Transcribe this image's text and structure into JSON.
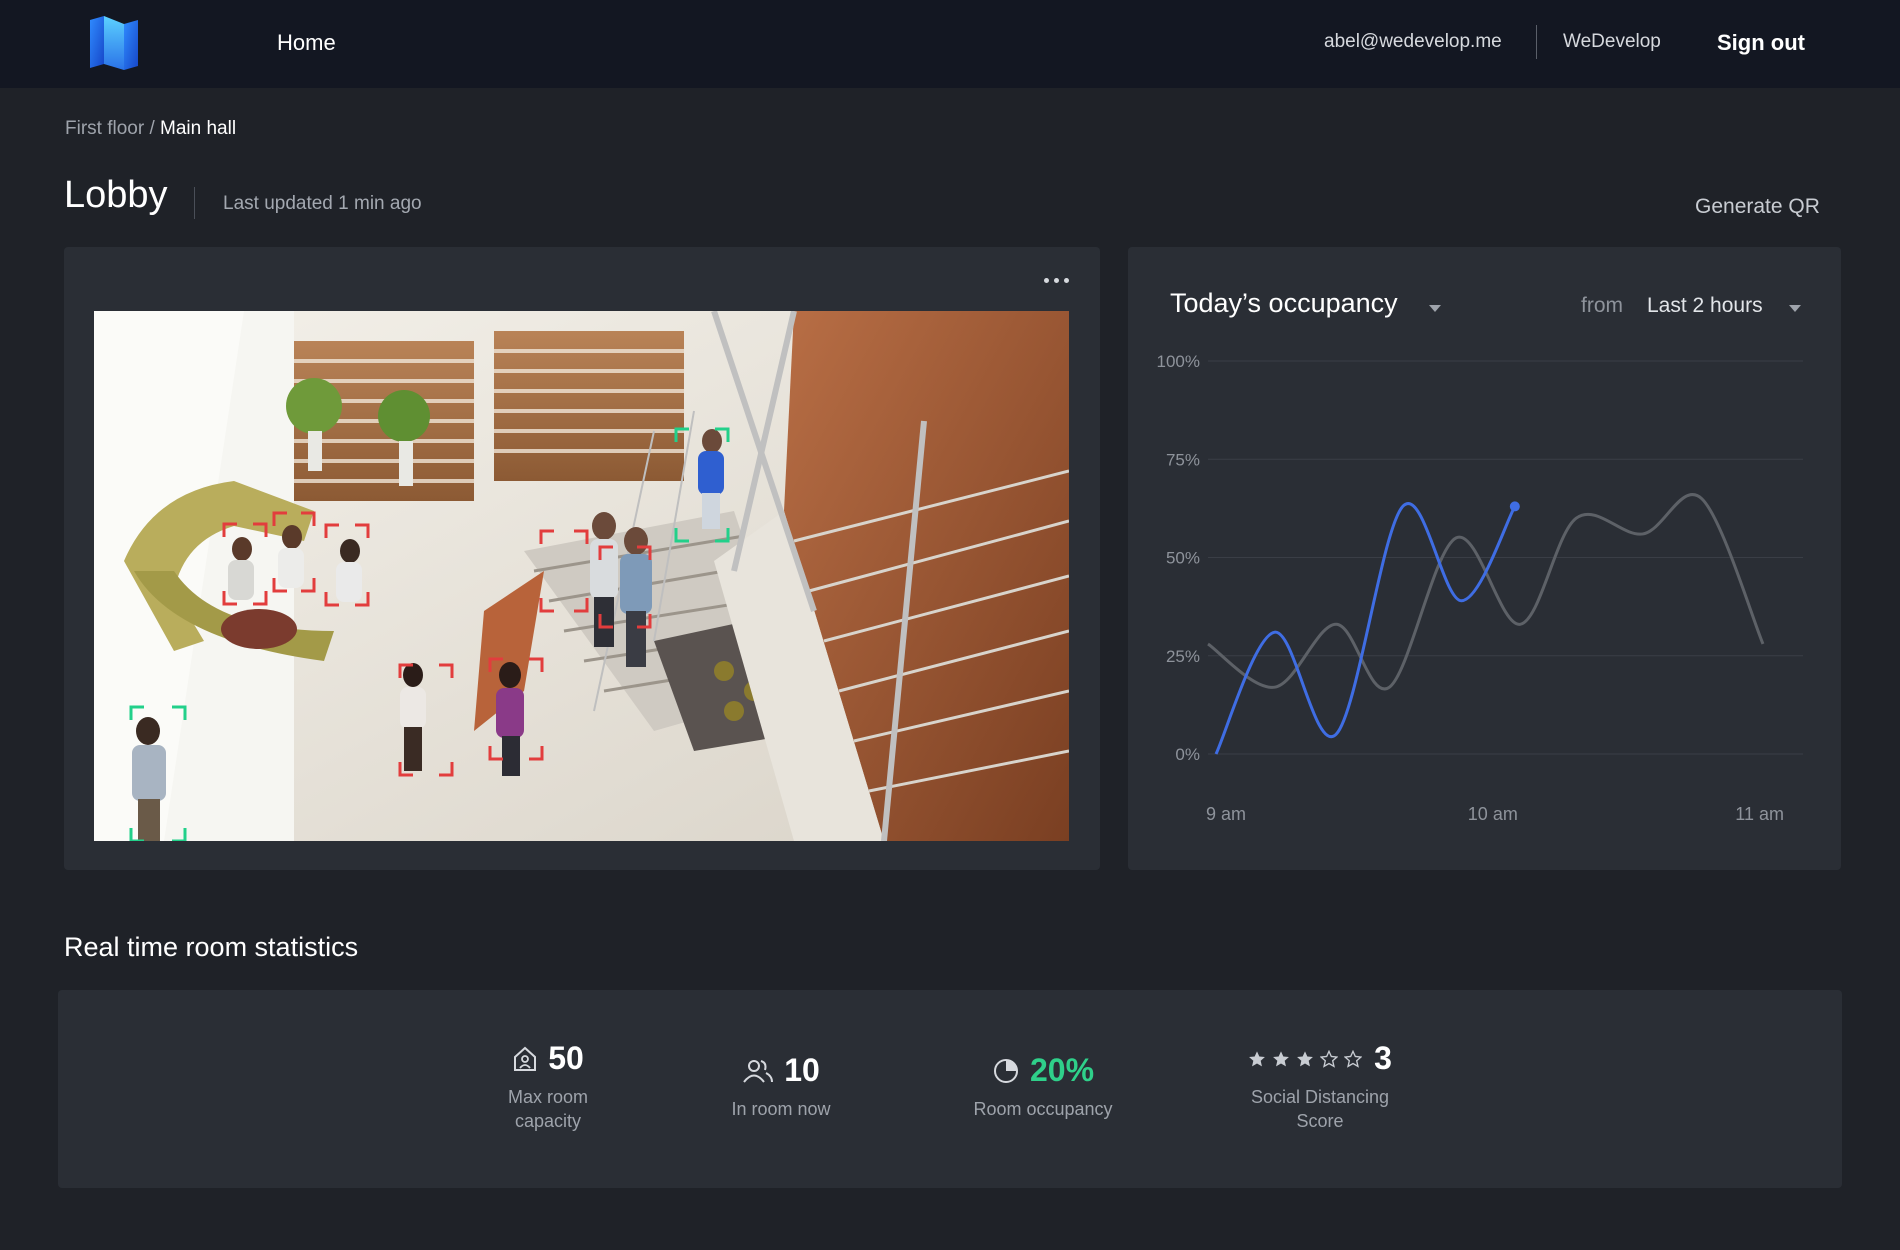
{
  "nav": {
    "home": "Home",
    "email": "abel@wedevelop.me",
    "org": "WeDevelop",
    "signout": "Sign out"
  },
  "breadcrumb": {
    "parent": "First floor",
    "separator": " / ",
    "current": "Main hall"
  },
  "page": {
    "title": "Lobby",
    "updated": "Last updated 1 min ago",
    "generate_qr": "Generate QR"
  },
  "camera": {
    "detections": [
      {
        "status": "violation"
      },
      {
        "status": "violation"
      },
      {
        "status": "violation"
      },
      {
        "status": "violation"
      },
      {
        "status": "violation"
      },
      {
        "status": "violation"
      },
      {
        "status": "violation"
      },
      {
        "status": "ok"
      },
      {
        "status": "ok"
      }
    ]
  },
  "colors": {
    "accent_blue": "#3f6de3",
    "comparison_gray": "#5d6167",
    "violation_red": "#e23d3d",
    "ok_green": "#22d08a",
    "occupancy_green": "#2fd08a"
  },
  "chart_data": {
    "type": "line",
    "title": "Today’s occupancy",
    "range_label": "from",
    "range_value": "Last 2 hours",
    "yticks": [
      "100%",
      "75%",
      "50%",
      "25%",
      "0%"
    ],
    "xticks": [
      "9 am",
      "10 am",
      "11 am"
    ],
    "ylim": [
      0,
      100
    ],
    "series": [
      {
        "values": [
          [
            9.0,
            0
          ],
          [
            9.22,
            31
          ],
          [
            9.45,
            5
          ],
          [
            9.7,
            63
          ],
          [
            9.92,
            39
          ],
          [
            10.12,
            63
          ]
        ]
      },
      {
        "values": [
          [
            8.97,
            28
          ],
          [
            9.22,
            17
          ],
          [
            9.45,
            33
          ],
          [
            9.65,
            17
          ],
          [
            9.9,
            55
          ],
          [
            10.14,
            33
          ],
          [
            10.35,
            60
          ],
          [
            10.6,
            56
          ],
          [
            10.82,
            65
          ],
          [
            11.05,
            28
          ]
        ]
      }
    ],
    "grid": true
  },
  "stats": {
    "title": "Real time room statistics",
    "max_capacity": {
      "value": "50",
      "label_line1": "Max room",
      "label_line2": "capacity"
    },
    "in_room": {
      "value": "10",
      "label": "In room now"
    },
    "occupancy": {
      "value": "20%",
      "label": "Room occupancy"
    },
    "distancing": {
      "value": "3",
      "rating": 3,
      "max_rating": 5,
      "label_line1": "Social Distancing",
      "label_line2": "Score"
    }
  }
}
